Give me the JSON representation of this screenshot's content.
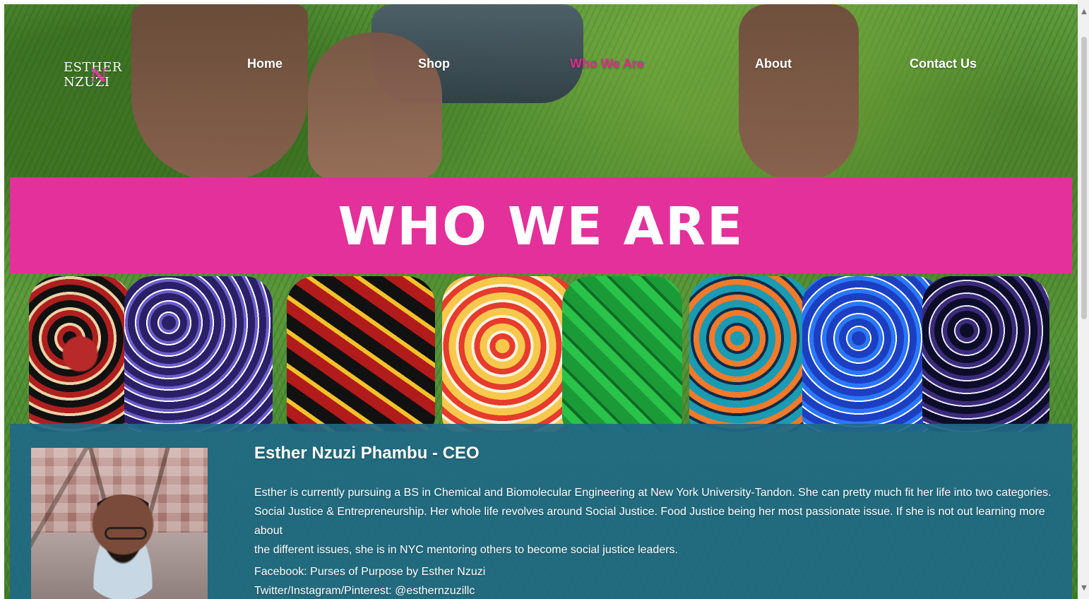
{
  "nav": {
    "logo_text": "ESTHER NZUZI",
    "items": [
      {
        "label": "Home"
      },
      {
        "label": "Shop"
      },
      {
        "label": "Who We Are"
      },
      {
        "label": "About"
      },
      {
        "label": "Contact Us"
      }
    ],
    "active_index": 2
  },
  "banner": {
    "title": "WHO WE ARE"
  },
  "profile": {
    "title": "Esther Nzuzi Phambu - CEO",
    "bio_lines": [
      "Esther is currently pursuing a BS in Chemical and Biomolecular Engineering at New York University-Tandon. She can pretty much fit her life into two categories.",
      "Social Justice & Entrepreneurship. Her whole life revolves around Social Justice. Food Justice being her most passionate issue. If she is not out learning more about",
      "the different issues, she is in NYC mentoring others to become social justice leaders."
    ],
    "social_lines": [
      "Facebook: Purses of Purpose by Esther Nzuzi",
      "Twitter/Instagram/Pinterest: @esthernzuzillc"
    ]
  },
  "colors": {
    "brand_pink": "#e3309a",
    "nav_active": "#e02b8e",
    "panel_blue": "#206884",
    "text_white": "#ffffff"
  },
  "icons": {
    "scroll_up": "triangle-up",
    "scroll_down": "triangle-down"
  }
}
